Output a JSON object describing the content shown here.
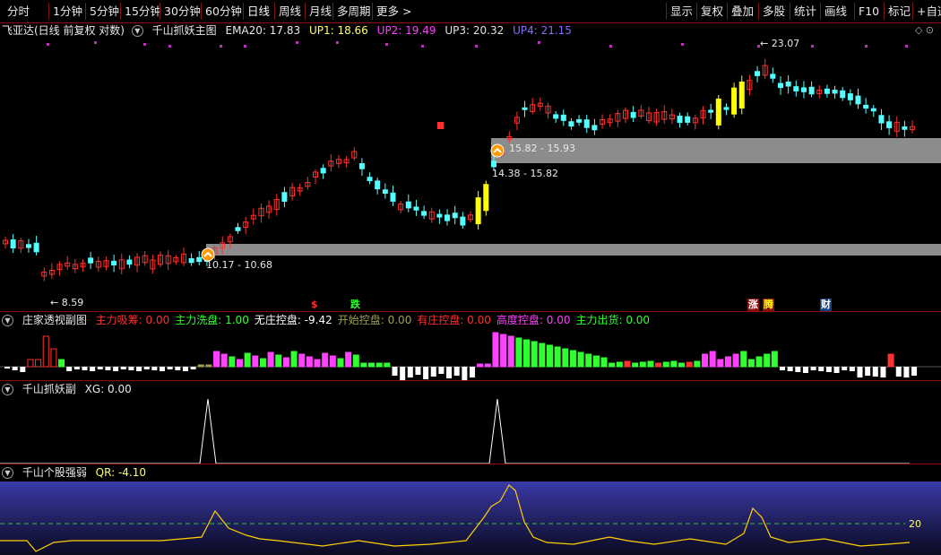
{
  "toolbar": {
    "left": [
      "分时",
      "1分钟",
      "5分钟",
      "15分钟",
      "30分钟",
      "60分钟",
      "日线",
      "周线",
      "月线",
      "多周期",
      "更多"
    ],
    "more_arrow": ">",
    "right": [
      "显示",
      "复权",
      "叠加",
      "多股",
      "统计",
      "画线",
      "F10",
      "标记",
      "+自选"
    ]
  },
  "main": {
    "stock_label": "飞亚达(日线 前复权 对数)",
    "indicator_name": "千山抓妖主图",
    "ema": "EMA20: 17.83",
    "up1": "UP1: 18.66",
    "up2": "UP2: 19.49",
    "up3": "UP3: 20.32",
    "up4": "UP4: 21.15",
    "zone_low_label": "10.17 - 10.68",
    "zone_high_label": "15.82 - 15.93",
    "zone_mid_label": "14.38 - 15.82",
    "low_marker": "8.59",
    "high_marker": "23.07",
    "signals": {
      "s": "$",
      "die": "跌",
      "zhang": "涨",
      "teng": "腾",
      "cai": "财"
    },
    "colors": {
      "up": "#ff3030",
      "down": "#54ffff",
      "ema": "#ffffff",
      "up1": "#ffff66",
      "up2": "#ff40ff",
      "up3": "#e0e0e0",
      "up4": "#7b5cff",
      "zone": "#8c8c8c",
      "yellow": "#ffff00"
    }
  },
  "zhuangjia": {
    "title": "庄家透视副图",
    "items": [
      {
        "label": "主力吸筹: 0.00",
        "color": "#ff3030"
      },
      {
        "label": "主力洗盘: 1.00",
        "color": "#30ff30"
      },
      {
        "label": "无庄控盘: -9.42",
        "color": "#ffffff"
      },
      {
        "label": "开始控盘: 0.00",
        "color": "#a0a050"
      },
      {
        "label": "有庄控盘: 0.00",
        "color": "#ff3030"
      },
      {
        "label": "高度控盘: 0.00",
        "color": "#ff40ff"
      },
      {
        "label": "主力出货: 0.00",
        "color": "#30ff30"
      }
    ]
  },
  "zhuayao": {
    "title": "千山抓妖副",
    "value": "XG: 0.00"
  },
  "qiangruo": {
    "title": "千山个股强弱",
    "value": "QR: -4.10",
    "level_label": "20"
  }
}
